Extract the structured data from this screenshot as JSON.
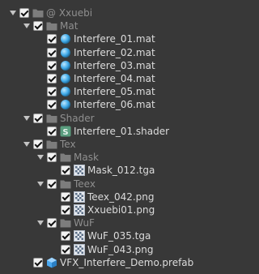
{
  "tree": [
    {
      "label": "@ Xxuebi",
      "icon": "folder-icon",
      "depth": 0,
      "arrow": true,
      "dim": true
    },
    {
      "label": "Mat",
      "icon": "folder-icon",
      "depth": 1,
      "arrow": true,
      "dim": true
    },
    {
      "label": "Interfere_01.mat",
      "icon": "material-icon",
      "depth": 2,
      "arrow": false,
      "dim": false
    },
    {
      "label": "Interfere_02.mat",
      "icon": "material-icon",
      "depth": 2,
      "arrow": false,
      "dim": false
    },
    {
      "label": "Interfere_03.mat",
      "icon": "material-icon",
      "depth": 2,
      "arrow": false,
      "dim": false
    },
    {
      "label": "Interfere_04.mat",
      "icon": "material-icon",
      "depth": 2,
      "arrow": false,
      "dim": false
    },
    {
      "label": "Interfere_05.mat",
      "icon": "material-icon",
      "depth": 2,
      "arrow": false,
      "dim": false
    },
    {
      "label": "Interfere_06.mat",
      "icon": "material-icon",
      "depth": 2,
      "arrow": false,
      "dim": false
    },
    {
      "label": "Shader",
      "icon": "folder-icon",
      "depth": 1,
      "arrow": true,
      "dim": true
    },
    {
      "label": "Interfere_01.shader",
      "icon": "shader-icon",
      "depth": 2,
      "arrow": false,
      "dim": false
    },
    {
      "label": "Tex",
      "icon": "folder-icon",
      "depth": 1,
      "arrow": true,
      "dim": true
    },
    {
      "label": "Mask",
      "icon": "folder-icon",
      "depth": 2,
      "arrow": true,
      "dim": true
    },
    {
      "label": "Mask_012.tga",
      "icon": "texture-icon",
      "depth": 3,
      "arrow": false,
      "dim": false
    },
    {
      "label": "Teex",
      "icon": "folder-icon",
      "depth": 2,
      "arrow": true,
      "dim": true
    },
    {
      "label": "Teex_042.png",
      "icon": "texture-icon",
      "depth": 3,
      "arrow": false,
      "dim": false
    },
    {
      "label": "Xxuebi01.png",
      "icon": "texture-icon",
      "depth": 3,
      "arrow": false,
      "dim": false
    },
    {
      "label": "WuF",
      "icon": "folder-icon",
      "depth": 2,
      "arrow": true,
      "dim": true
    },
    {
      "label": "WuF_035.tga",
      "icon": "texture-icon",
      "depth": 3,
      "arrow": false,
      "dim": false
    },
    {
      "label": "WuF_043.png",
      "icon": "texture-icon",
      "depth": 3,
      "arrow": false,
      "dim": false
    },
    {
      "label": "VFX_Interfere_Demo.prefab",
      "icon": "prefab-icon",
      "depth": 1,
      "arrow": false,
      "dim": false
    }
  ],
  "colors": {
    "background": "#383838",
    "text": "#dcdcdc",
    "folder_text": "#8f8f8f",
    "folder_icon": "#7d7d7d",
    "material_icon": "#3fa9e8",
    "shader_icon": "#5a9d7e",
    "prefab_icon": "#4aa8f0"
  }
}
